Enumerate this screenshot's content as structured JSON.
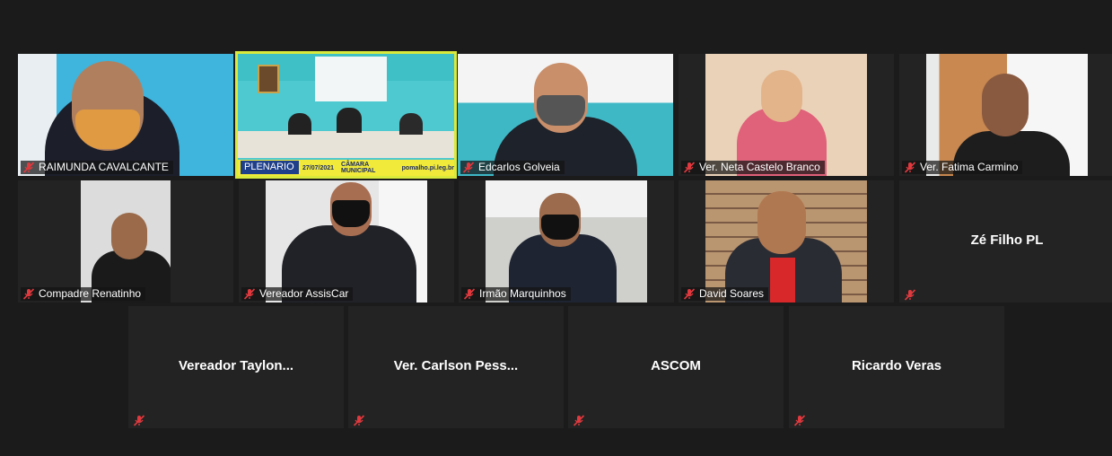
{
  "participants": [
    {
      "name": "RAIMUNDA CAVALCANTE",
      "muted": true,
      "video": true
    },
    {
      "name": "PLENARIO",
      "muted": false,
      "video": true,
      "active_speaker": true,
      "banner": {
        "date": "27/07/2021",
        "title": "CÂMARA MUNICIPAL",
        "site": "pomalho.pi.leg.br"
      }
    },
    {
      "name": "Edcarlos Golveia",
      "muted": true,
      "video": true
    },
    {
      "name": "Ver. Neta Castelo Branco",
      "muted": true,
      "video": true
    },
    {
      "name": "Ver. Fatima Carmino",
      "muted": true,
      "video": true
    },
    {
      "name": "Compadre Renatinho",
      "muted": true,
      "video": true
    },
    {
      "name": "Vereador AssisCar",
      "muted": true,
      "video": true
    },
    {
      "name": "Irmão Marquinhos",
      "muted": true,
      "video": true
    },
    {
      "name": "David Soares",
      "muted": true,
      "video": true
    },
    {
      "name": "Zé Filho PL",
      "muted": true,
      "video": false
    },
    {
      "name": "Vereador  Taylon...",
      "muted": true,
      "video": false
    },
    {
      "name": "Ver. Carlson Pess...",
      "muted": true,
      "video": false
    },
    {
      "name": "ASCOM",
      "muted": true,
      "video": false
    },
    {
      "name": "Ricardo Veras",
      "muted": true,
      "video": false
    }
  ],
  "colors": {
    "background": "#1b1b1b",
    "tile": "#232323",
    "active_border": "#d9ea3c",
    "muted_icon": "#e0393e"
  },
  "icons": {
    "muted": "mic-muted-icon"
  }
}
